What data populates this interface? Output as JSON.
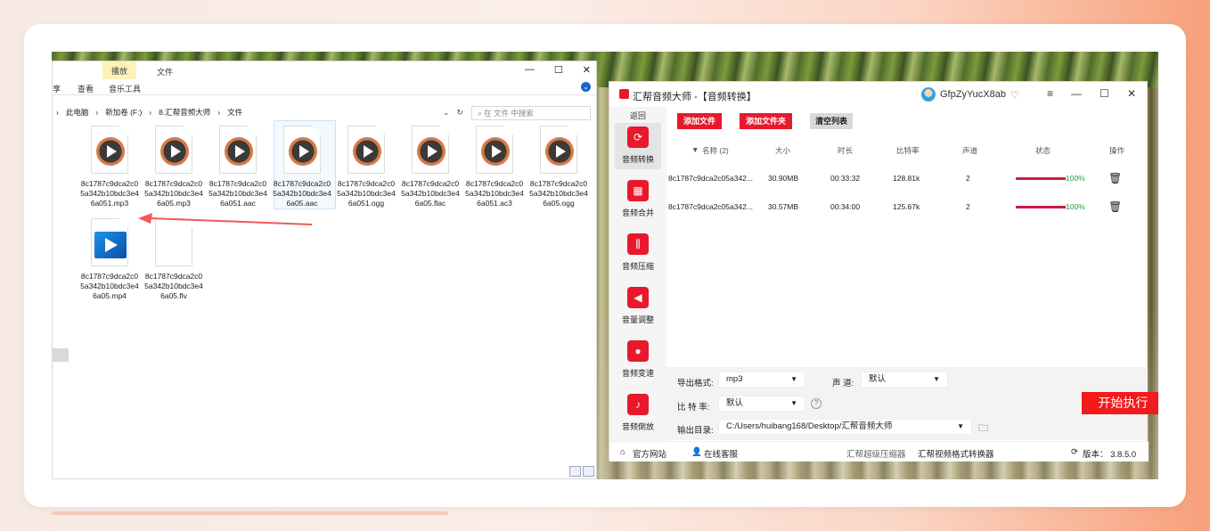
{
  "explorer": {
    "tabs": {
      "play": "播放",
      "file": "文件"
    },
    "ribbon": {
      "share": "享",
      "view": "查看",
      "music_tools": "音乐工具"
    },
    "window_buttons": {
      "minimize": "—",
      "maximize": "☐",
      "close": "✕"
    },
    "address": [
      "此电脑",
      "新加卷 (F:)",
      "8.汇帮音频大师",
      "文件"
    ],
    "address_separator": "›",
    "search_placeholder": "在 文件 中搜索",
    "files": [
      {
        "name": "8c1787c9dca2c05a342b10bdc3e46a051.mp3",
        "type": "audio"
      },
      {
        "name": "8c1787c9dca2c05a342b10bdc3e46a05.mp3",
        "type": "audio"
      },
      {
        "name": "8c1787c9dca2c05a342b10bdc3e46a051.aac",
        "type": "audio"
      },
      {
        "name": "8c1787c9dca2c05a342b10bdc3e46a05.aac",
        "type": "audio"
      },
      {
        "name": "8c1787c9dca2c05a342b10bdc3e46a051.ogg",
        "type": "audio"
      },
      {
        "name": "8c1787c9dca2c05a342b10bdc3e46a05.flac",
        "type": "audio"
      },
      {
        "name": "8c1787c9dca2c05a342b10bdc3e46a051.ac3",
        "type": "audio"
      },
      {
        "name": "8c1787c9dca2c05a342b10bdc3e46a05.ogg",
        "type": "audio"
      },
      {
        "name": "8c1787c9dca2c05a342b10bdc3e46a05.mp4",
        "type": "video"
      },
      {
        "name": "8c1787c9dca2c05a342b10bdc3e46a05.flv",
        "type": "blank"
      }
    ]
  },
  "app": {
    "title": "汇帮音频大师  -【音频转换】",
    "user": "GfpZyYucX8ab",
    "window_buttons": {
      "menu": "≡",
      "minimize": "—",
      "maximize": "☐",
      "close": "✕"
    },
    "sidebar": {
      "back": "返回",
      "items": [
        {
          "label": "音频转换",
          "icon": "audio-convert-icon"
        },
        {
          "label": "音频合并",
          "icon": "audio-merge-icon"
        },
        {
          "label": "音频压缩",
          "icon": "audio-compress-icon"
        },
        {
          "label": "音量调整",
          "icon": "volume-icon"
        },
        {
          "label": "音频变速",
          "icon": "speed-icon"
        },
        {
          "label": "音频倒放",
          "icon": "reverse-icon"
        }
      ]
    },
    "toolbar": {
      "add_file": "添加文件",
      "add_folder": "添加文件夹",
      "clear_list": "清空列表"
    },
    "table": {
      "headers": {
        "name": "名称 (2)",
        "size": "大小",
        "duration": "时长",
        "bitrate": "比特率",
        "channels": "声道",
        "status": "状态",
        "actions": "操作"
      },
      "rows": [
        {
          "name": "8c1787c9dca2c05a342...",
          "size": "30.90MB",
          "duration": "00:33:32",
          "bitrate": "128.81k",
          "channels": "2",
          "progress": "100%"
        },
        {
          "name": "8c1787c9dca2c05a342...",
          "size": "30.57MB",
          "duration": "00:34:00",
          "bitrate": "125.67k",
          "channels": "2",
          "progress": "100%"
        }
      ]
    },
    "settings": {
      "format_label": "导出格式:",
      "format_value": "mp3",
      "channel_label": "声 道:",
      "channel_value": "默认",
      "bitrate_label": "比 特 率:",
      "bitrate_value": "默认",
      "help": "?",
      "output_label": "输出目录:",
      "output_value": "C:/Users/huibang168/Desktop/汇帮音频大师",
      "caret": "▼",
      "start": "开始执行"
    },
    "footer": {
      "website": "官方网站",
      "support": "在线客服",
      "compressor": "汇帮超级压缩器",
      "video_converter": "汇帮视频格式转换器",
      "version": "版本：  3.8.5.0"
    }
  }
}
